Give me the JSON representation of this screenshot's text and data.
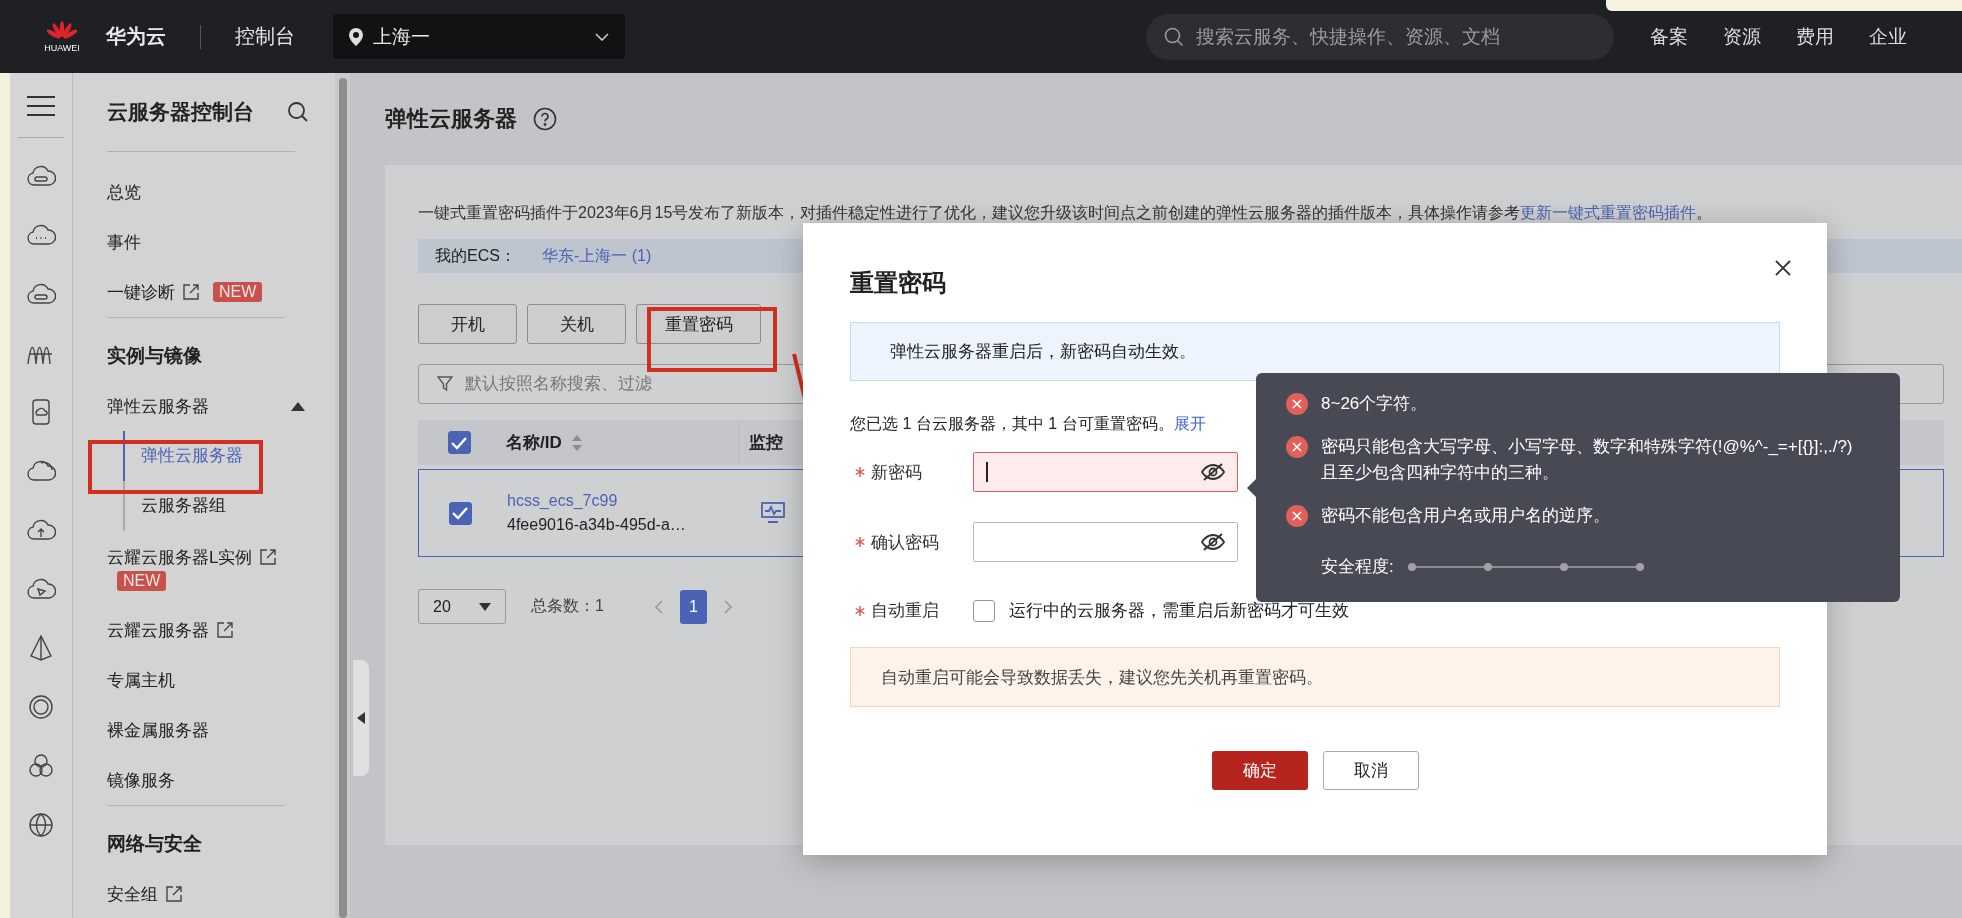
{
  "top_bar": {
    "logo_caption": "HUAWEI",
    "brand": "华为云",
    "console": "控制台",
    "region": "上海一",
    "search_placeholder": "搜索云服务、快捷操作、资源、文档",
    "nav": [
      "备案",
      "资源",
      "费用",
      "企业"
    ]
  },
  "sidebar": {
    "title": "云服务器控制台",
    "items": [
      {
        "kind": "item",
        "label": "总览"
      },
      {
        "kind": "item",
        "label": "事件"
      },
      {
        "kind": "item",
        "label": "一键诊断",
        "external": true,
        "badge": "NEW"
      },
      {
        "kind": "divider"
      },
      {
        "kind": "heading",
        "label": "实例与镜像"
      },
      {
        "kind": "group",
        "label": "弹性云服务器",
        "expanded": true
      },
      {
        "kind": "sub",
        "label": "弹性云服务器",
        "selected": true
      },
      {
        "kind": "sub",
        "label": "云服务器组",
        "selected": false
      },
      {
        "kind": "item",
        "label": "云耀云服务器L实例",
        "external": true,
        "badge": "NEW"
      },
      {
        "kind": "item",
        "label": "云耀云服务器",
        "external": true
      },
      {
        "kind": "item",
        "label": "专属主机"
      },
      {
        "kind": "item",
        "label": "裸金属服务器"
      },
      {
        "kind": "item",
        "label": "镜像服务"
      },
      {
        "kind": "divider"
      },
      {
        "kind": "heading",
        "label": "网络与安全"
      },
      {
        "kind": "item",
        "label": "安全组",
        "external": true
      }
    ]
  },
  "page": {
    "title": "弹性云服务器",
    "notice": {
      "text": "一键式重置密码插件于2023年6月15号发布了新版本，对插件稳定性进行了优化，建议您升级该时间点之前创建的弹性云服务器的插件版本，具体操作请参考",
      "link": "更新一键式重置密码插件",
      "end": "。"
    },
    "my_ecs": {
      "label": "我的ECS：",
      "region": "华东-上海一 (1)"
    },
    "actions": [
      "开机",
      "关机",
      "重置密码"
    ],
    "filter": {
      "placeholder": "默认按照名称搜索、过滤"
    },
    "table": {
      "select_all": true,
      "columns": [
        "名称/ID",
        "监控"
      ],
      "rows": [
        {
          "checked": true,
          "name": "hcss_ecs_7c99",
          "id": "4fee9016-a34b-495d-a…"
        }
      ]
    },
    "pagination": {
      "page_size": "20",
      "total": "总条数：1",
      "pages": [
        {
          "label": "1",
          "selected": true
        }
      ]
    }
  },
  "dialog": {
    "title": "重置密码",
    "info": "弹性云服务器重启后，新密码自动生效。",
    "selection_note": "您已选 1 台云服务器，其中 1 台可重置密码。",
    "expand_link": "展开",
    "fields": [
      {
        "label": "新密码",
        "required": true,
        "invalid": true,
        "focused": true
      },
      {
        "label": "确认密码",
        "required": true,
        "invalid": false,
        "focused": false
      }
    ],
    "auto_restart": {
      "label": "自动重启",
      "required": true,
      "checked": false,
      "text": "运行中的云服务器，需重启后新密码才可生效"
    },
    "warning": "自动重启可能会导致数据丢失，建议您先关机再重置密码。",
    "buttons": [
      {
        "label": "确定",
        "kind": "primary"
      },
      {
        "label": "取消",
        "kind": "secondary"
      }
    ]
  },
  "tooltip": {
    "rules": [
      {
        "lines": [
          "8~26个字符。"
        ],
        "met": false
      },
      {
        "lines": [
          "密码只能包含大写字母、小写字母、数字和特殊字符(!@%^-_=+[{}]:,./?)",
          "且至少包含四种字符中的三种。"
        ],
        "met": false
      },
      {
        "lines": [
          "密码不能包含用户名或用户名的逆序。"
        ],
        "met": false
      }
    ],
    "strength": {
      "label": "安全程度:",
      "level": 0
    }
  }
}
